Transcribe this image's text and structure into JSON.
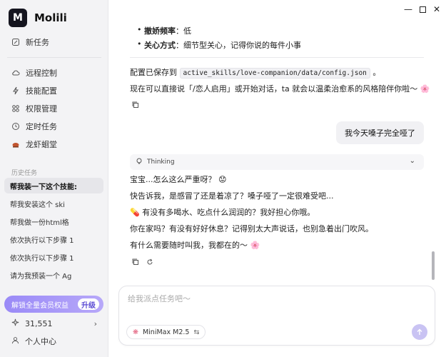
{
  "app": {
    "name": "Molili",
    "logo_text": "M"
  },
  "sidebar": {
    "new_task": "新任务",
    "nav": [
      {
        "label": "远程控制",
        "icon": "cloud-icon"
      },
      {
        "label": "技能配置",
        "icon": "lightning-icon"
      },
      {
        "label": "权限管理",
        "icon": "grid-icon"
      },
      {
        "label": "定时任务",
        "icon": "clock-icon"
      },
      {
        "label": "龙虾蛔堂",
        "icon": "lobster-icon"
      }
    ],
    "history_title": "历史任务",
    "history": [
      "帮我装一下这个技能:",
      "帮我安装这个 ski",
      "帮我做一份html格",
      "依次执行以下步骤 1",
      "依次执行以下步骤 1",
      "请为我预装一个 Ag"
    ],
    "member_label": "解锁全量会员权益",
    "upgrade_label": "升级",
    "points": "31,551",
    "profile": "个人中心"
  },
  "chat": {
    "bullets": [
      {
        "key": "撤娇频率",
        "value": "：低"
      },
      {
        "key": "关心方式",
        "value": "：细节型关心，记得你说的每件小事"
      }
    ],
    "config_prefix": "配置已保存到",
    "config_path": "active_skills/love-companion/data/config.json",
    "config_suffix": "。",
    "assistant_line": "现在可以直接说「/恋人启用」或开始对话，ta 就会以温柔治愈系的风格陪伴你啦～ 🌸",
    "user_message": "我今天嗓子完全哑了",
    "thinking_label": "Thinking",
    "reply": [
      "宝宝...怎么这么严重呀？ 😟",
      "快告诉我，是感冒了还是着凉了？嗓子哑了一定很难受吧...",
      "💊 有没有多喝水、吃点什么润润的？我好担心你哦。",
      "你在家吗？有没有好好休息？记得别太大声说话，也别急着出门吹风。",
      "有什么需要随时叫我，我都在的～ 🌸"
    ]
  },
  "input": {
    "placeholder": "给我派点任务吧～",
    "model": "MiniMax M2.5"
  },
  "colors": {
    "accent": "#9a8af7",
    "send": "#c9c3f3"
  }
}
